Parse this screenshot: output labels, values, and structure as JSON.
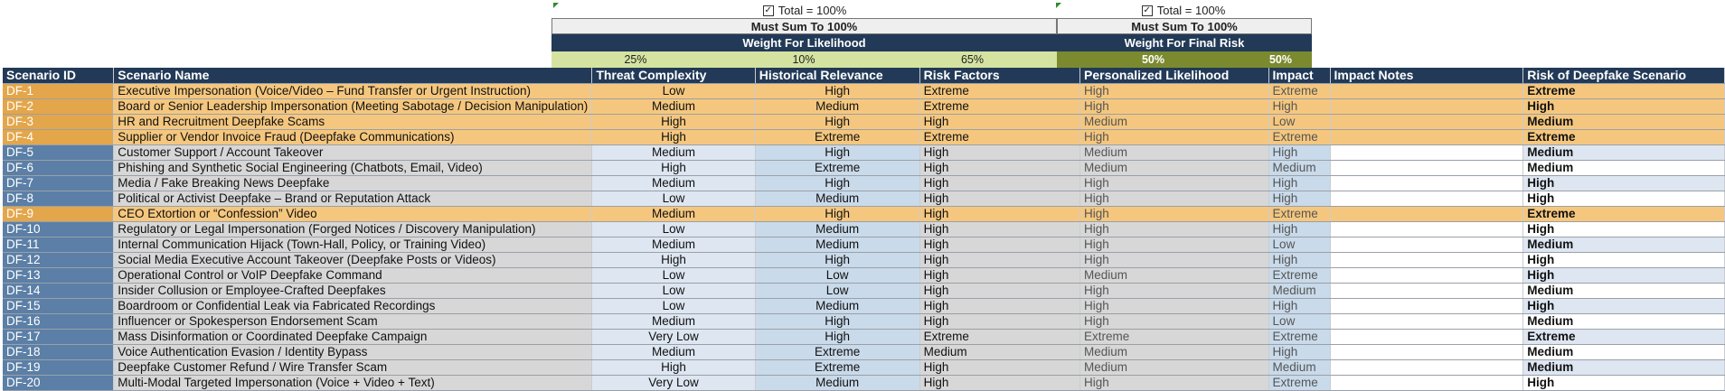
{
  "header": {
    "checkbox_label_1": "Total = 100%",
    "checkbox_label_2": "Total = 100%",
    "must_sum_1": "Must Sum To 100%",
    "must_sum_2": "Must Sum To 100%",
    "weight_likelihood": "Weight For  Likelihood",
    "weight_final": "Weight For Final Risk",
    "pct_threat": "25%",
    "pct_historical": "10%",
    "pct_risk": "65%",
    "pct_likelihood": "50%",
    "pct_impact": "50%"
  },
  "columns": [
    "Scenario ID",
    "Scenario Name",
    "Threat Complexity",
    "Historical Relevance",
    "Risk Factors",
    "Personalized Likelihood",
    "Impact",
    "Impact Notes",
    "Risk of Deepfake Scenario"
  ],
  "rows": [
    {
      "id": "DF-1",
      "name": "Executive Impersonation (Voice/Video – Fund Transfer or Urgent Instruction)",
      "threat": "Low",
      "hist": "High",
      "rf": "Extreme",
      "pl": "High",
      "impact": "Extreme",
      "notes": "",
      "risk": "Extreme",
      "hl": true
    },
    {
      "id": "DF-2",
      "name": "Board or Senior Leadership Impersonation (Meeting Sabotage / Decision Manipulation)",
      "threat": "Medium",
      "hist": "Medium",
      "rf": "Extreme",
      "pl": "High",
      "impact": "High",
      "notes": "",
      "risk": "High",
      "hl": true
    },
    {
      "id": "DF-3",
      "name": "HR and Recruitment Deepfake Scams",
      "threat": "High",
      "hist": "High",
      "rf": "High",
      "pl": "Medium",
      "impact": "Low",
      "notes": "",
      "risk": "Medium",
      "hl": true
    },
    {
      "id": "DF-4",
      "name": "Supplier or Vendor Invoice Fraud (Deepfake Communications)",
      "threat": "High",
      "hist": "Extreme",
      "rf": "Extreme",
      "pl": "High",
      "impact": "Extreme",
      "notes": "",
      "risk": "Extreme",
      "hl": true
    },
    {
      "id": "DF-5",
      "name": "Customer Support / Account Takeover",
      "threat": "Medium",
      "hist": "High",
      "rf": "High",
      "pl": "Medium",
      "impact": "High",
      "notes": "",
      "risk": "Medium",
      "hl": false
    },
    {
      "id": "DF-6",
      "name": "Phishing and Synthetic Social Engineering (Chatbots, Email, Video)",
      "threat": "High",
      "hist": "Extreme",
      "rf": "High",
      "pl": "Medium",
      "impact": "Medium",
      "notes": "",
      "risk": "Medium",
      "hl": false
    },
    {
      "id": "DF-7",
      "name": "Media / Fake Breaking News Deepfake",
      "threat": "Medium",
      "hist": "High",
      "rf": "High",
      "pl": "High",
      "impact": "High",
      "notes": "",
      "risk": "High",
      "hl": false
    },
    {
      "id": "DF-8",
      "name": "Political or Activist Deepfake – Brand or Reputation Attack",
      "threat": "Low",
      "hist": "Medium",
      "rf": "High",
      "pl": "High",
      "impact": "High",
      "notes": "",
      "risk": "High",
      "hl": false
    },
    {
      "id": "DF-9",
      "name": "CEO Extortion or “Confession” Video",
      "threat": "Medium",
      "hist": "High",
      "rf": "High",
      "pl": "High",
      "impact": "Extreme",
      "notes": "",
      "risk": "Extreme",
      "hl": true
    },
    {
      "id": "DF-10",
      "name": "Regulatory or Legal Impersonation (Forged Notices / Discovery Manipulation)",
      "threat": "Low",
      "hist": "Medium",
      "rf": "High",
      "pl": "High",
      "impact": "High",
      "notes": "",
      "risk": "High",
      "hl": false
    },
    {
      "id": "DF-11",
      "name": "Internal Communication Hijack (Town-Hall, Policy, or Training Video)",
      "threat": "Medium",
      "hist": "Medium",
      "rf": "High",
      "pl": "High",
      "impact": "Low",
      "notes": "",
      "risk": "Medium",
      "hl": false
    },
    {
      "id": "DF-12",
      "name": "Social Media Executive Account Takeover (Deepfake Posts or Videos)",
      "threat": "High",
      "hist": "High",
      "rf": "High",
      "pl": "High",
      "impact": "High",
      "notes": "",
      "risk": "High",
      "hl": false
    },
    {
      "id": "DF-13",
      "name": "Operational Control or VoIP Deepfake Command",
      "threat": "Low",
      "hist": "Low",
      "rf": "High",
      "pl": "Medium",
      "impact": "Extreme",
      "notes": "",
      "risk": "High",
      "hl": false
    },
    {
      "id": "DF-14",
      "name": "Insider Collusion or Employee-Crafted Deepfakes",
      "threat": "Low",
      "hist": "Low",
      "rf": "High",
      "pl": "High",
      "impact": "Medium",
      "notes": "",
      "risk": "Medium",
      "hl": false
    },
    {
      "id": "DF-15",
      "name": "Boardroom or Confidential Leak via Fabricated Recordings",
      "threat": "Low",
      "hist": "Medium",
      "rf": "High",
      "pl": "High",
      "impact": "High",
      "notes": "",
      "risk": "High",
      "hl": false
    },
    {
      "id": "DF-16",
      "name": "Influencer or Spokesperson Endorsement Scam",
      "threat": "Medium",
      "hist": "High",
      "rf": "High",
      "pl": "High",
      "impact": "Low",
      "notes": "",
      "risk": "Medium",
      "hl": false
    },
    {
      "id": "DF-17",
      "name": "Mass Disinformation or Coordinated Deepfake Campaign",
      "threat": "Very Low",
      "hist": "High",
      "rf": "Extreme",
      "pl": "Extreme",
      "impact": "Extreme",
      "notes": "",
      "risk": "Extreme",
      "hl": false
    },
    {
      "id": "DF-18",
      "name": "Voice Authentication Evasion / Identity Bypass",
      "threat": "Medium",
      "hist": "Extreme",
      "rf": "Medium",
      "pl": "Medium",
      "impact": "High",
      "notes": "",
      "risk": "Medium",
      "hl": false
    },
    {
      "id": "DF-19",
      "name": "Deepfake Customer Refund / Wire Transfer Scam",
      "threat": "High",
      "hist": "Extreme",
      "rf": "High",
      "pl": "Medium",
      "impact": "Medium",
      "notes": "",
      "risk": "Medium",
      "hl": false
    },
    {
      "id": "DF-20",
      "name": "Multi-Modal Targeted Impersonation (Voice + Video + Text)",
      "threat": "Very Low",
      "hist": "Medium",
      "rf": "High",
      "pl": "High",
      "impact": "Extreme",
      "notes": "",
      "risk": "High",
      "hl": false
    }
  ]
}
